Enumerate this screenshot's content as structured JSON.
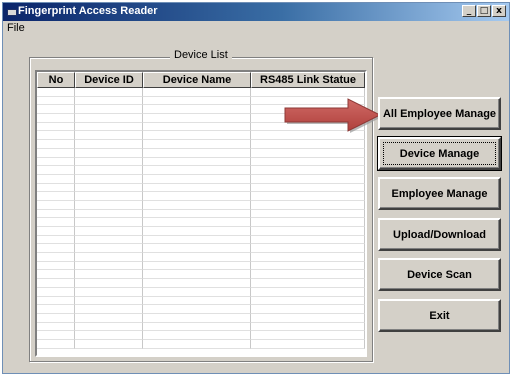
{
  "window": {
    "title": "Fingerprint Access Reader",
    "controls": {
      "minimize": "_",
      "maximize": "□",
      "close": "x"
    }
  },
  "menu": {
    "file": "File"
  },
  "device_list": {
    "legend": "Device List",
    "columns": [
      "No",
      "Device ID",
      "Device Name",
      "RS485 Link Statue"
    ],
    "empty_row_count": 30
  },
  "buttons": {
    "all_employee_manage": "All Employee Manage",
    "device_manage": "Device Manage",
    "employee_manage": "Employee Manage",
    "upload_download": "Upload/Download",
    "device_scan": "Device Scan",
    "exit": "Exit"
  },
  "colors": {
    "titlebar_start": "#0a246a",
    "titlebar_end": "#a6caf0",
    "face": "#d4d0c8",
    "arrow_fill": "#c0504d",
    "arrow_outline": "#8c3836"
  },
  "annotation": {
    "icon": "red-arrow-icon",
    "points_to": "All Employee Manage"
  }
}
